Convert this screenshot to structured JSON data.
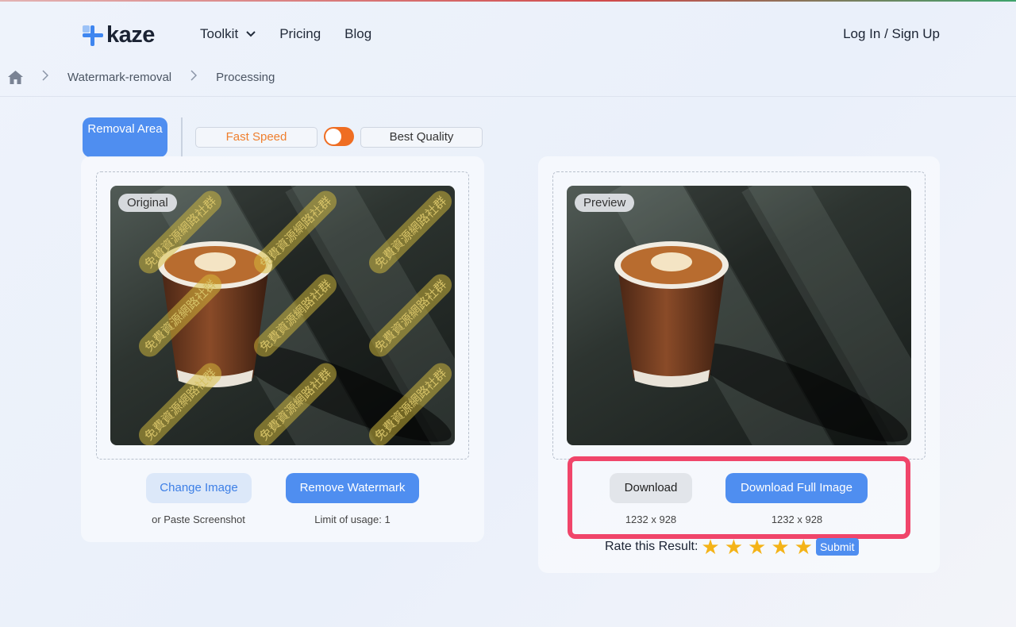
{
  "brand": {
    "name": "kaze",
    "accent": "#3f86f0"
  },
  "nav": {
    "toolkit": "Toolkit",
    "pricing": "Pricing",
    "blog": "Blog"
  },
  "auth": {
    "login": "Log In / Sign Up"
  },
  "breadcrumb": {
    "items": [
      "Watermark-removal",
      "Processing"
    ]
  },
  "controls": {
    "removal_area": "Removal Area",
    "fast_speed": "Fast Speed",
    "best_quality": "Best Quality",
    "toggle_color": "#ef6d22"
  },
  "original": {
    "badge": "Original",
    "watermark_text": "免費資源網路社群",
    "change_image": "Change Image",
    "paste_hint": "or Paste Screenshot",
    "remove_watermark": "Remove Watermark",
    "usage_limit": "Limit of usage: 1"
  },
  "preview": {
    "badge": "Preview",
    "download": "Download",
    "download_size": "1232 x 928",
    "download_full": "Download Full Image",
    "download_full_size": "1232 x 928"
  },
  "rating": {
    "label": "Rate this Result:",
    "stars": 5,
    "submit": "Submit"
  },
  "colors": {
    "primary_button": "#4f8ef0",
    "highlight_box": "#f0456a",
    "star": "#f4b318"
  }
}
